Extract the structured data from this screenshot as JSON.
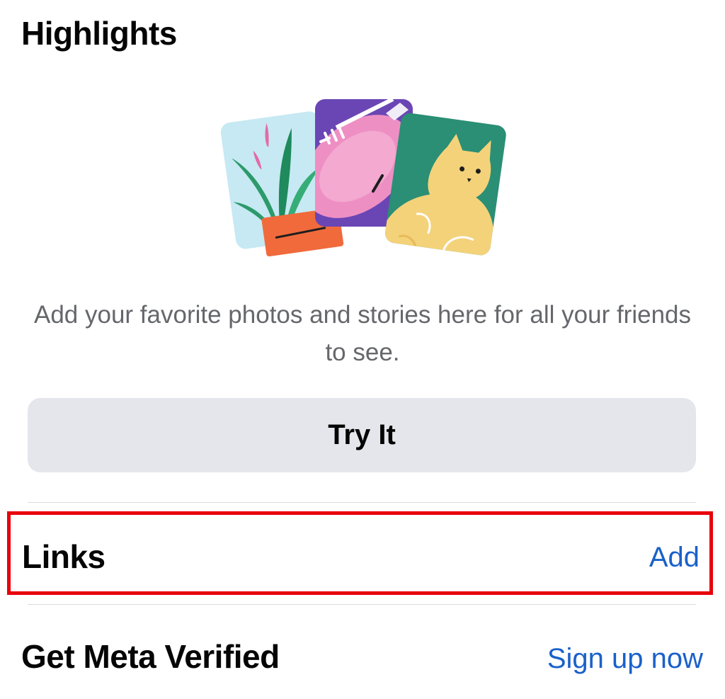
{
  "highlights": {
    "title": "Highlights",
    "description": "Add your favorite photos and stories here for all your friends to see.",
    "try_button_label": "Try It"
  },
  "links": {
    "title": "Links",
    "action_label": "Add",
    "highlight_border_color": "#e8000b"
  },
  "meta_verified": {
    "title": "Get Meta Verified",
    "action_label": "Sign up now"
  },
  "colors": {
    "link_blue": "#1a61c9",
    "button_gray": "#e4e6eb",
    "secondary_text": "#65676b"
  },
  "illustration": {
    "cards": [
      "plant-card-icon",
      "football-card-icon",
      "cat-card-icon"
    ]
  }
}
